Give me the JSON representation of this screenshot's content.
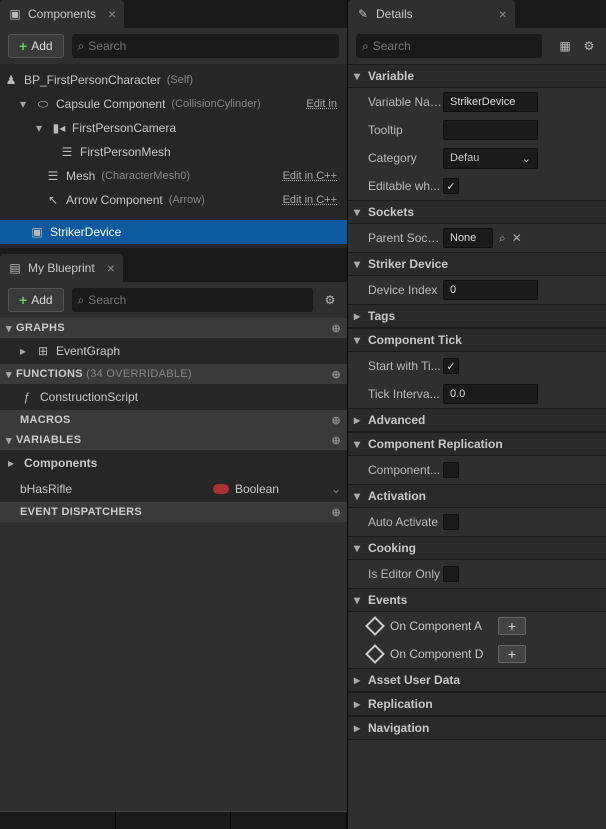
{
  "components": {
    "tab_title": "Components",
    "add_label": "Add",
    "search_placeholder": "Search",
    "tree": {
      "root": "BP_FirstPersonCharacter",
      "root_suffix": "(Self)",
      "capsule": "Capsule Component",
      "capsule_suffix": "(CollisionCylinder)",
      "capsule_edit": "Edit in",
      "camera": "FirstPersonCamera",
      "fp_mesh": "FirstPersonMesh",
      "mesh": "Mesh",
      "mesh_suffix": "(CharacterMesh0)",
      "mesh_edit": "Edit in C++",
      "arrow": "Arrow Component",
      "arrow_suffix": "(Arrow)",
      "arrow_edit": "Edit in C++",
      "striker": "StrikerDevice"
    }
  },
  "my_blueprint": {
    "tab_title": "My Blueprint",
    "add_label": "Add",
    "search_placeholder": "Search",
    "graphs_label": "GRAPHS",
    "event_graph": "EventGraph",
    "functions_label": "FUNCTIONS",
    "functions_suffix": "(34 OVERRIDABLE)",
    "construction": "ConstructionScript",
    "macros_label": "MACROS",
    "variables_label": "VARIABLES",
    "components_var": "Components",
    "bhasrifle": "bHasRifle",
    "bool_type": "Boolean",
    "dispatchers_label": "EVENT DISPATCHERS"
  },
  "details": {
    "tab_title": "Details",
    "search_placeholder": "Search",
    "cat_variable": "Variable",
    "var_name_label": "Variable Name",
    "var_name_val": "StrikerDevice",
    "tooltip_label": "Tooltip",
    "category_label": "Category",
    "category_val": "Defau",
    "editable_label": "Editable wh...",
    "cat_sockets": "Sockets",
    "parent_socket_label": "Parent Socket",
    "parent_socket_val": "None",
    "cat_striker": "Striker Device",
    "device_index_label": "Device Index",
    "device_index_val": "0",
    "cat_tags": "Tags",
    "cat_tick": "Component Tick",
    "start_tick_label": "Start with Ti...",
    "tick_interval_label": "Tick Interva...",
    "tick_interval_val": "0.0",
    "advanced_label": "Advanced",
    "cat_replication": "Component Replication",
    "component_rep_label": "Component...",
    "cat_activation": "Activation",
    "auto_activate_label": "Auto Activate",
    "cat_cooking": "Cooking",
    "editor_only_label": "Is Editor Only",
    "cat_events": "Events",
    "event_a": "On Component A",
    "event_d": "On Component D",
    "cat_asset": "Asset User Data",
    "cat_repl2": "Replication",
    "cat_nav": "Navigation"
  }
}
